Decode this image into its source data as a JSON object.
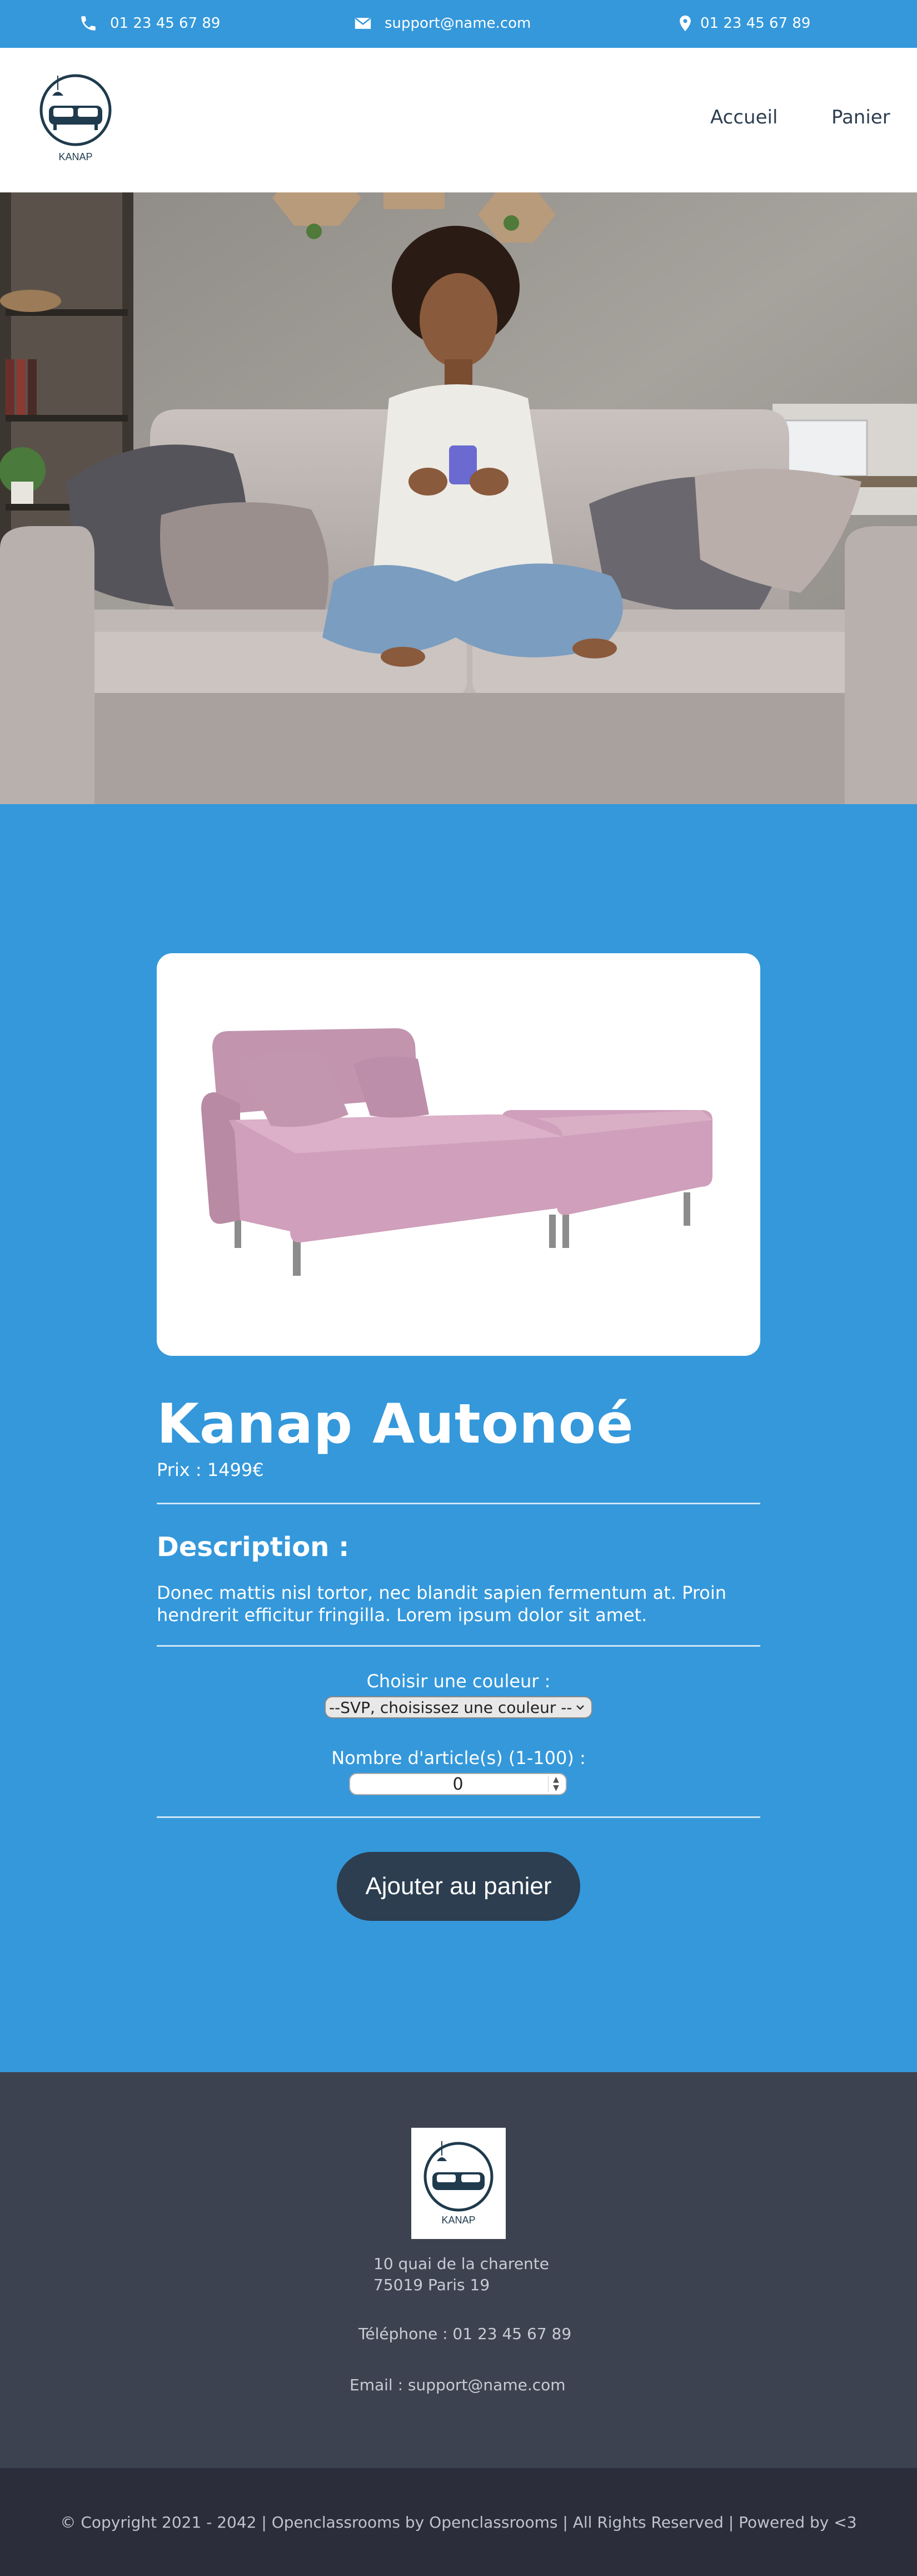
{
  "topbar": {
    "phone_left": "01 23 45 67 89",
    "email": "support@name.com",
    "phone_right": "01 23 45 67 89"
  },
  "header": {
    "logo_text": "KANAP",
    "nav": [
      "Accueil",
      "Panier"
    ]
  },
  "product": {
    "title": "Kanap Autonoé",
    "price": "Prix : 1499€",
    "description_title": "Description :",
    "description": "Donec mattis nisl tortor, nec blandit sapien fermentum at. Proin hendrerit efficitur fringilla. Lorem ipsum dolor sit amet.",
    "color_label": "Choisir une couleur :",
    "color_selected": "--SVP, choisissez une couleur --",
    "quantity_label": "Nombre d'article(s) (1-100) :",
    "quantity_value": "0",
    "add_button": "Ajouter au panier"
  },
  "footer": {
    "logo_text": "KANAP",
    "address_line1": "10 quai de la charente",
    "address_line2": "75019 Paris 19",
    "phone": "Téléphone : 01 23 45 67 89",
    "email": "Email : support@name.com",
    "copyright": "© Copyright 2021 - 2042 | Openclassrooms by Openclassrooms | All Rights Reserved | Powered by <3"
  },
  "colors": {
    "brand_blue": "#3498db",
    "dark_navy": "#2c3e50",
    "footer_bg": "#3d4250",
    "copyright_bg": "#2b2e3a",
    "sofa_pink": "#c79bb6"
  },
  "icons": [
    "phone-icon",
    "envelope-icon",
    "map-pin-icon"
  ]
}
